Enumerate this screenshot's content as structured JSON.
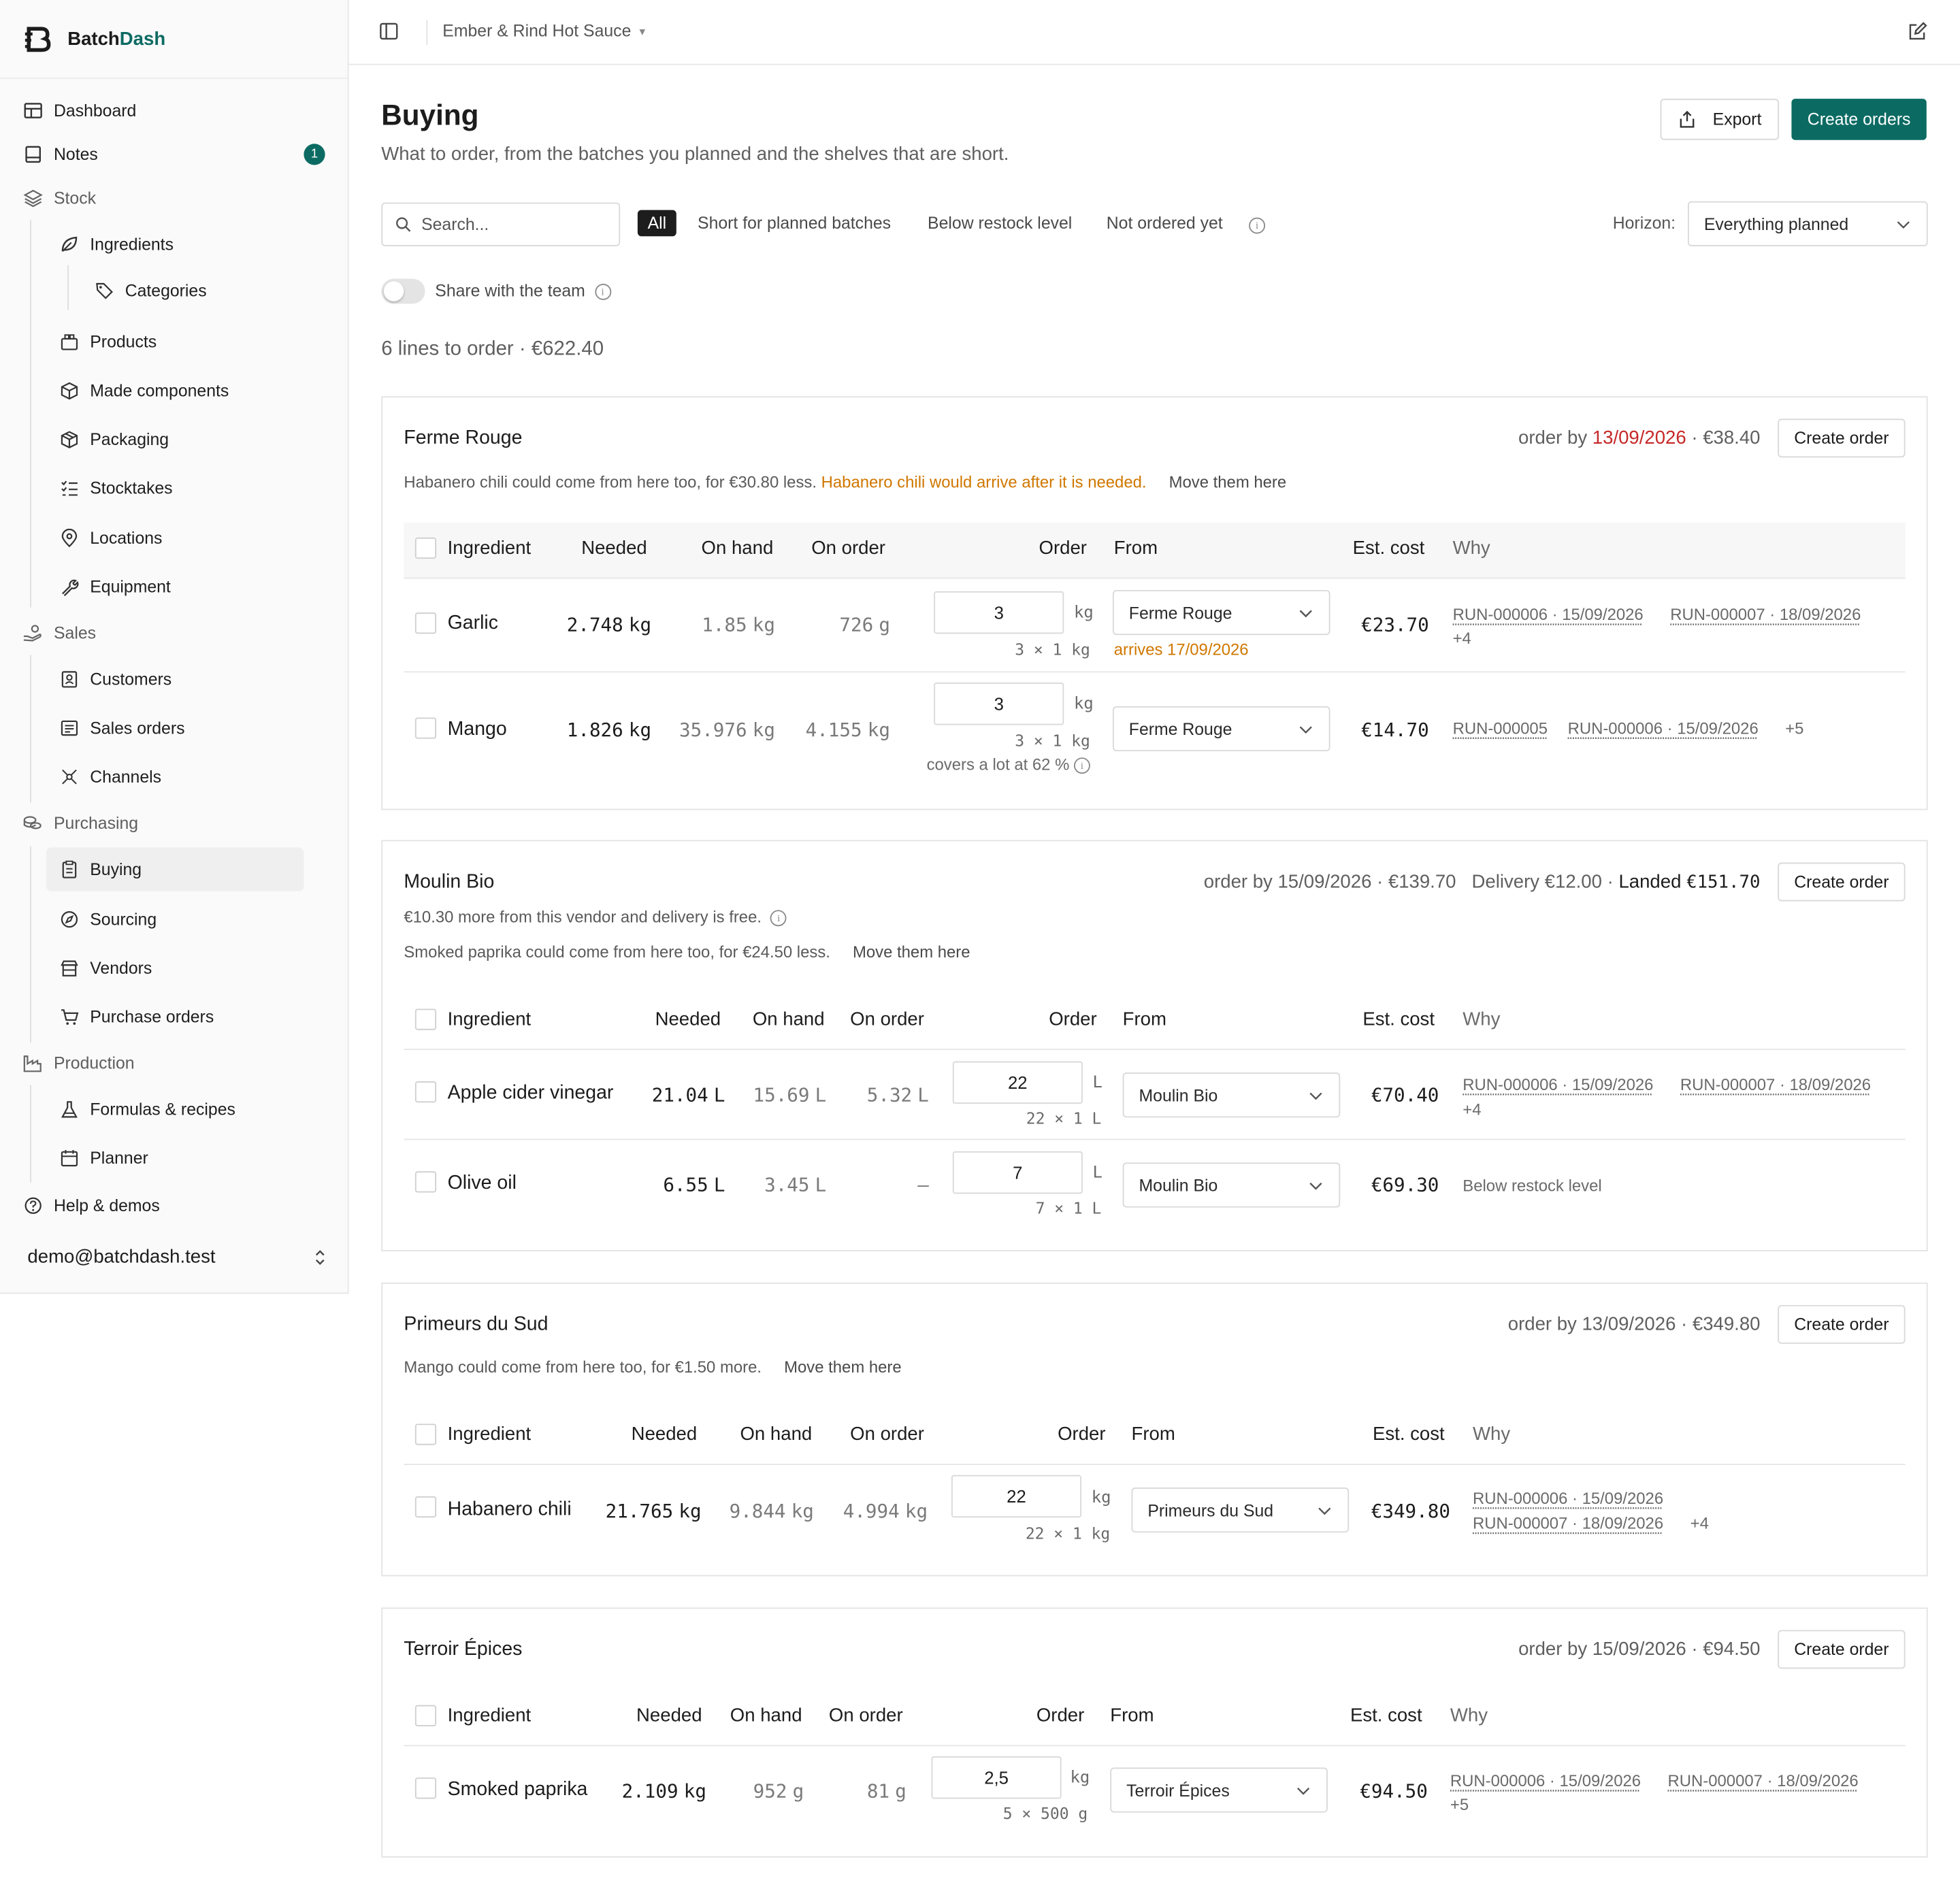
{
  "app": {
    "brand_part1": "Batch",
    "brand_part2": "Dash",
    "accent_color": "#0b6b63",
    "workspace": "Ember & Rind Hot Sauce"
  },
  "sidebar": {
    "items": {
      "dashboard": "Dashboard",
      "notes": "Notes",
      "notes_badge": "1",
      "stock": "Stock",
      "ingredients": "Ingredients",
      "categories": "Categories",
      "products": "Products",
      "made_components": "Made components",
      "packaging": "Packaging",
      "stocktakes": "Stocktakes",
      "locations": "Locations",
      "equipment": "Equipment",
      "sales": "Sales",
      "customers": "Customers",
      "sales_orders": "Sales orders",
      "channels": "Channels",
      "purchasing": "Purchasing",
      "buying": "Buying",
      "sourcing": "Sourcing",
      "vendors": "Vendors",
      "purchase_orders": "Purchase orders",
      "production": "Production",
      "formulas": "Formulas & recipes",
      "planner": "Planner",
      "help": "Help & demos"
    },
    "user_email": "demo@batchdash.test"
  },
  "page": {
    "title": "Buying",
    "subtitle": "What to order, from the batches you planned and the shelves that are short.",
    "export_label": "Export",
    "create_orders_label": "Create orders",
    "search_placeholder": "Search...",
    "filters": {
      "all": "All",
      "short": "Short for planned batches",
      "below": "Below restock level",
      "not_ordered": "Not ordered yet"
    },
    "horizon_label": "Horizon:",
    "horizon_value": "Everything planned",
    "share_label": "Share with the team",
    "summary": "6 lines to order · €622.40"
  },
  "columns": {
    "ingredient": "Ingredient",
    "needed": "Needed",
    "on_hand": "On hand",
    "on_order": "On order",
    "order": "Order",
    "from": "From",
    "est_cost": "Est. cost",
    "why": "Why"
  },
  "create_order_label": "Create order",
  "move_label": "Move them here",
  "vendors": [
    {
      "name": "Ferme Rouge",
      "order_by_prefix": "order by ",
      "order_by_date": "13/09/2026",
      "order_by_suffix": " · €38.40",
      "note": "Habanero chili could come from here too, for €30.80 less.",
      "warning": "Habanero chili would arrive after it is needed.",
      "rows": [
        {
          "name": "Garlic",
          "needed": "2.748",
          "needed_unit": "kg",
          "on_hand": "1.85",
          "on_hand_unit": "kg",
          "on_order": "726",
          "on_order_unit": "g",
          "order_qty": "3",
          "order_unit": "kg",
          "pack": "3 × 1 kg",
          "from": "Ferme Rouge",
          "arrives": "arrives 17/09/2026",
          "cost": "€23.70",
          "why": [
            "RUN-000006 · 15/09/2026",
            "RUN-000007 · 18/09/2026"
          ],
          "why_more": "+4"
        },
        {
          "name": "Mango",
          "needed": "1.826",
          "needed_unit": "kg",
          "on_hand": "35.976",
          "on_hand_unit": "kg",
          "on_order": "4.155",
          "on_order_unit": "kg",
          "order_qty": "3",
          "order_unit": "kg",
          "pack": "3 × 1 kg",
          "covers": "covers a lot at 62 %",
          "from": "Ferme Rouge",
          "cost": "€14.70",
          "why": [
            "RUN-000005",
            "RUN-000006 · 15/09/2026"
          ],
          "why_more": "+5"
        }
      ]
    },
    {
      "name": "Moulin Bio",
      "order_by_text": "order by 15/09/2026 · €139.70",
      "delivery_text": "Delivery €12.00 · ",
      "landed_label": "Landed",
      "landed_value": "€151.70",
      "free_note": "€10.30 more from this vendor and delivery is free.",
      "note": "Smoked paprika could come from here too, for €24.50 less.",
      "rows": [
        {
          "name": "Apple cider vinegar",
          "needed": "21.04",
          "needed_unit": "L",
          "on_hand": "15.69",
          "on_hand_unit": "L",
          "on_order": "5.32",
          "on_order_unit": "L",
          "order_qty": "22",
          "order_unit": "L",
          "pack": "22 × 1 L",
          "from": "Moulin Bio",
          "cost": "€70.40",
          "why": [
            "RUN-000006 · 15/09/2026",
            "RUN-000007 · 18/09/2026"
          ],
          "why_more": "+4"
        },
        {
          "name": "Olive oil",
          "needed": "6.55",
          "needed_unit": "L",
          "on_hand": "3.45",
          "on_hand_unit": "L",
          "on_order": "–",
          "order_qty": "7",
          "order_unit": "L",
          "pack": "7 × 1 L",
          "from": "Moulin Bio",
          "cost": "€69.30",
          "why_text": "Below restock level"
        }
      ]
    },
    {
      "name": "Primeurs du Sud",
      "order_by_text": "order by 13/09/2026 · €349.80",
      "note": "Mango could come from here too, for €1.50 more.",
      "rows": [
        {
          "name": "Habanero chili",
          "needed": "21.765",
          "needed_unit": "kg",
          "on_hand": "9.844",
          "on_hand_unit": "kg",
          "on_order": "4.994",
          "on_order_unit": "kg",
          "order_qty": "22",
          "order_unit": "kg",
          "pack": "22 × 1 kg",
          "from": "Primeurs du Sud",
          "cost": "€349.80",
          "why": [
            "RUN-000006 · 15/09/2026",
            "RUN-000007 · 18/09/2026"
          ],
          "why_more": "+4"
        }
      ]
    },
    {
      "name": "Terroir Épices",
      "order_by_text": "order by 15/09/2026 · €94.50",
      "rows": [
        {
          "name": "Smoked paprika",
          "needed": "2.109",
          "needed_unit": "kg",
          "on_hand": "952",
          "on_hand_unit": "g",
          "on_order": "81",
          "on_order_unit": "g",
          "order_qty": "2,5",
          "order_unit": "kg",
          "pack": "5 × 500 g",
          "from": "Terroir Épices",
          "cost": "€94.50",
          "why": [
            "RUN-000006 · 15/09/2026",
            "RUN-000007 · 18/09/2026"
          ],
          "why_more": "+5"
        }
      ]
    }
  ]
}
